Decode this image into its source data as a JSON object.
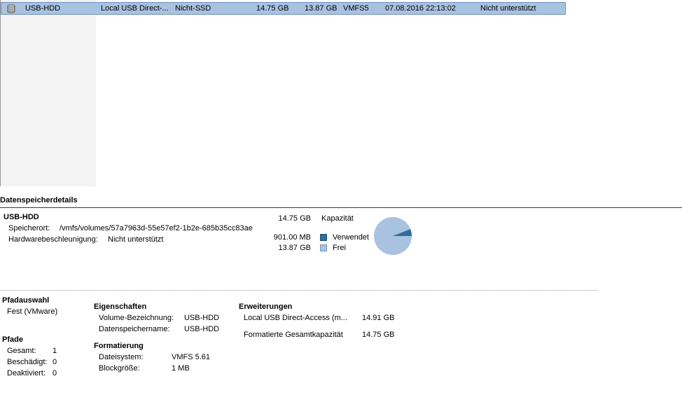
{
  "datastore_row": {
    "name": "USB-HDD",
    "device": "Local USB Direct-...",
    "drive_type": "Nicht-SSD",
    "capacity": "14.75 GB",
    "free": "13.87 GB",
    "type": "VMFS5",
    "last_update": "07.08.2016 22:13:02",
    "hw_accel": "Nicht unterstützt",
    "icon": "datastore-icon"
  },
  "details": {
    "title": "Datenspeicherdetails",
    "name": "USB-HDD",
    "location_label": "Speicherort:",
    "location_value": "/vmfs/volumes/57a7963d-55e57ef2-1b2e-685b35cc83ae",
    "hw_accel_label": "Hardwarebeschleunigung:",
    "hw_accel_value": "Nicht unterstützt",
    "capacity_value": "14.75 GB",
    "capacity_label": "Kapazität",
    "used_value": "901.00 MB",
    "used_label": "Verwendet",
    "free_value": "13.87 GB",
    "free_label": "Frei",
    "used_color": "#2f6d9b",
    "free_color": "#a9c2e0",
    "used_fraction": 0.0597
  },
  "path_selection": {
    "title": "Pfadauswahl",
    "value": "Fest (VMware)"
  },
  "paths": {
    "title": "Pfade",
    "total_label": "Gesamt:",
    "total_value": "1",
    "broken_label": "Beschädigt:",
    "broken_value": "0",
    "disabled_label": "Deaktiviert:",
    "disabled_value": "0"
  },
  "properties": {
    "title": "Eigenschaften",
    "volume_label": "Volume-Bezeichnung:",
    "volume_value": "USB-HDD",
    "ds_name_label": "Datenspeichername:",
    "ds_name_value": "USB-HDD"
  },
  "formatting": {
    "title": "Formatierung",
    "fs_label": "Dateisystem:",
    "fs_value": "VMFS 5.61",
    "block_label": "Blockgröße:",
    "block_value": "1 MB"
  },
  "extents": {
    "title": "Erweiterungen",
    "extent_name": "Local USB Direct-Access (m...",
    "extent_size": "14.91 GB",
    "total_label": "Formatierte Gesamtkapazität",
    "total_value": "14.75 GB"
  }
}
